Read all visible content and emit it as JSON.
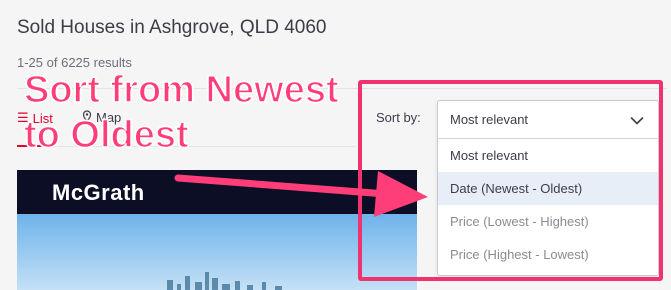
{
  "page": {
    "title": "Sold Houses in Ashgrove, QLD 4060",
    "results_count": "1-25 of 6225 results"
  },
  "view_tabs": {
    "list_label": "List",
    "list_icon": "list-icon",
    "map_label": "Map",
    "map_icon": "map-pin-icon"
  },
  "listing": {
    "brand": "McGrath"
  },
  "sort": {
    "label": "Sort by:",
    "selected": "Most relevant",
    "options": [
      "Most relevant",
      "Date (Newest - Oldest)",
      "Price (Lowest - Highest)",
      "Price (Highest - Lowest)"
    ],
    "highlighted_option": "Date (Newest - Oldest)"
  },
  "annotation": {
    "line1": "Sort from Newest",
    "line2": "to Oldest",
    "color": "#ff3d78"
  },
  "colors": {
    "accent_red": "#e4002b",
    "highlight_pink": "#f0336e",
    "option_hover": "#e8eef7",
    "brand_navy": "#0b0e24"
  }
}
